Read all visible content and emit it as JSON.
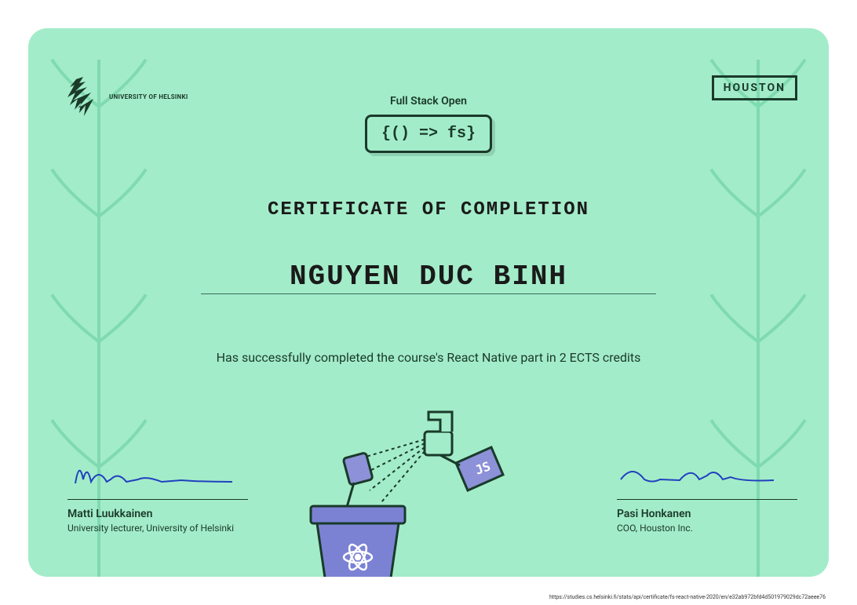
{
  "header": {
    "university_label": "UNIVERSITY OF HELSINKI",
    "partner_label": "HOUSTON",
    "course_name": "Full Stack Open",
    "code_snippet": "{() => fs}"
  },
  "title": "CERTIFICATE OF COMPLETION",
  "recipient": "NGUYEN DUC BINH",
  "completion_statement": "Has successfully completed the course's React Native part in 2 ECTS credits",
  "signatures": {
    "left": {
      "name": "Matti Luukkainen",
      "title": "University lecturer, University of Helsinki"
    },
    "right": {
      "name": "Pasi Honkanen",
      "title": "COO, Houston Inc."
    }
  },
  "illustration": {
    "spray_label": "JS"
  },
  "verification_url": "https://studies.cs.helsinki.fi/stats/api/certificate/fs-react-native-2020/en/e32ab972bfd4d501979029dc72aeee76"
}
